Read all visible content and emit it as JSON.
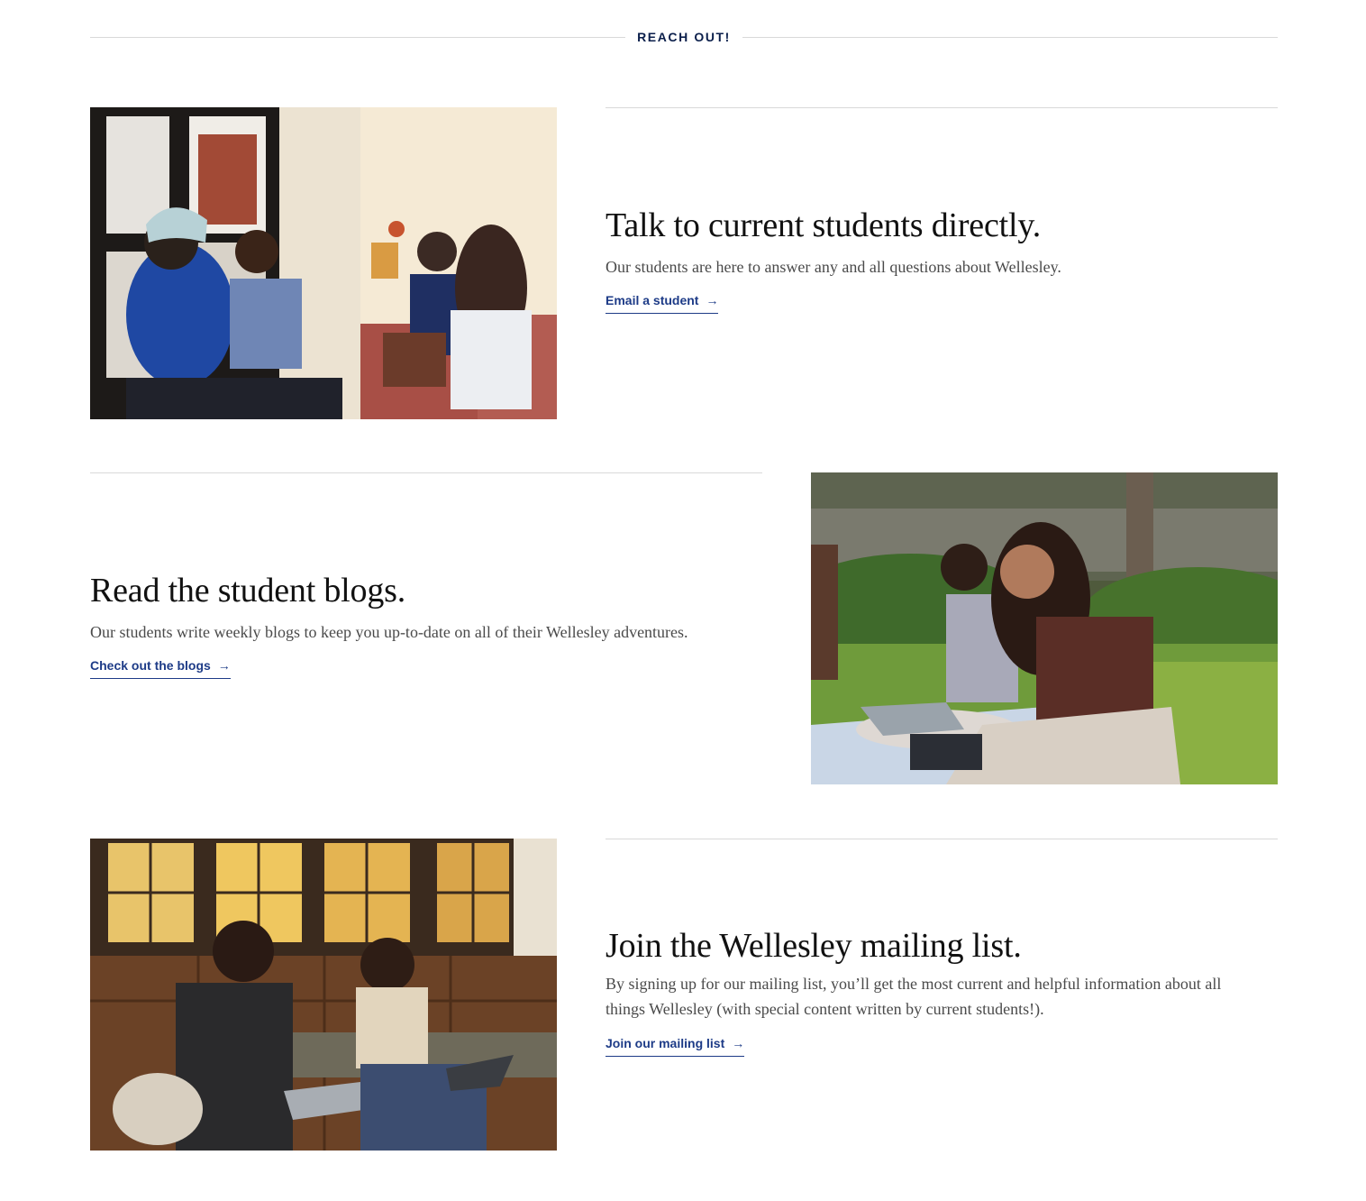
{
  "section": {
    "label": "REACH OUT!"
  },
  "colors": {
    "navy": "#0b1f4b",
    "link": "#1d3b87",
    "rule": "#d9d9d9",
    "body_text": "#4a4a4a"
  },
  "rows": [
    {
      "heading": "Talk to current students directly.",
      "description": "Our students are here to answer any and all questions about Wellesley.",
      "cta_label": "Email a student",
      "cta_icon": "arrow-right-icon",
      "image_alt": "Four students chatting in a sunlit dorm lounge by the window"
    },
    {
      "heading": "Read the student blogs.",
      "description": "Our students write weekly blogs to keep you up-to-date on all of their Wellesley adventures.",
      "cta_label": "Check out the blogs",
      "cta_icon": "arrow-right-icon",
      "image_alt": "Students sitting on a blanket on the grass working on laptops"
    },
    {
      "heading": "Join the Wellesley mailing list.",
      "description": "By signing up for our mailing list, you’ll get the most current and helpful information about all things Wellesley (with special content written by current students!).",
      "cta_label": "Join our mailing list",
      "cta_icon": "arrow-right-icon",
      "image_alt": "Two students with laptops talking on a window bench in a wood-paneled room"
    }
  ]
}
